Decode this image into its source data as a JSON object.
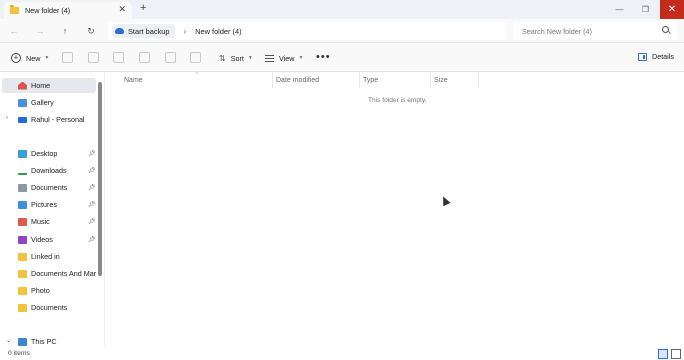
{
  "tab": {
    "title": "New folder (4)"
  },
  "address": {
    "backup_label": "Start backup",
    "current_folder": "New folder (4)",
    "search_placeholder": "Search New folder (4)"
  },
  "toolbar": {
    "new_label": "New",
    "sort_label": "Sort",
    "view_label": "View",
    "details_label": "Details"
  },
  "sidebar": {
    "items": [
      {
        "label": "Home",
        "icon": "home-icon",
        "selected": true
      },
      {
        "label": "Gallery",
        "icon": "gallery-icon"
      },
      {
        "label": "Rahul - Personal",
        "icon": "onedrive-cloud-icon",
        "expandable": true
      },
      {
        "label": "Desktop",
        "icon": "desktop-icon",
        "pinned": true
      },
      {
        "label": "Downloads",
        "icon": "downloads-icon",
        "pinned": true
      },
      {
        "label": "Documents",
        "icon": "documents-icon",
        "pinned": true
      },
      {
        "label": "Pictures",
        "icon": "pictures-icon",
        "pinned": true
      },
      {
        "label": "Music",
        "icon": "music-icon",
        "pinned": true
      },
      {
        "label": "Videos",
        "icon": "videos-icon",
        "pinned": true
      },
      {
        "label": "Linked in",
        "icon": "folder-icon"
      },
      {
        "label": "Documents And MarksS",
        "icon": "folder-icon"
      },
      {
        "label": "Photo",
        "icon": "folder-icon"
      },
      {
        "label": "Documents",
        "icon": "folder-icon"
      },
      {
        "label": "This PC",
        "icon": "pc-icon",
        "expandable": true
      }
    ]
  },
  "columns": {
    "name": "Name",
    "date_modified": "Date modified",
    "type": "Type",
    "size": "Size"
  },
  "content": {
    "empty_message": "This folder is empty."
  },
  "status": {
    "item_count": "0 items"
  },
  "colors": {
    "accent": "#2b6fd1",
    "close_red": "#c42b1c",
    "folder_yellow": "#f3c33f"
  }
}
